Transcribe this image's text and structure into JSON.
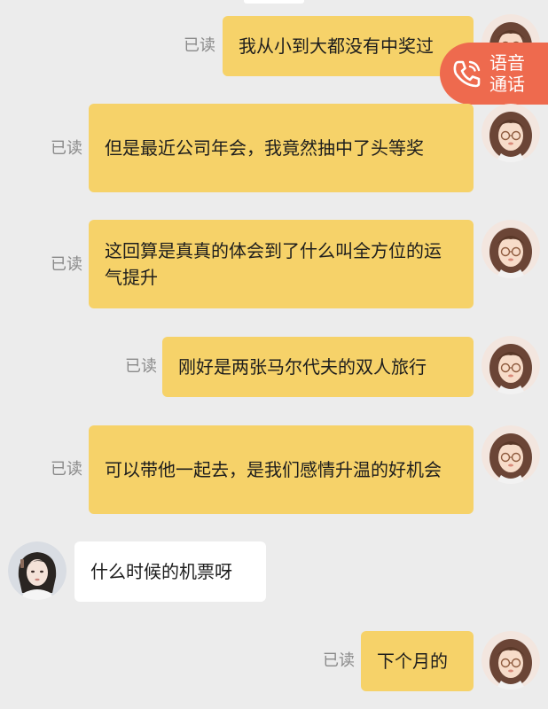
{
  "read_label": "已读",
  "messages": [
    {
      "sender": "me",
      "text": "我从小到大都没有中奖过",
      "read": "已读"
    },
    {
      "sender": "me",
      "text": "但是最近公司年会，我竟然抽中了头等奖",
      "read": "已读"
    },
    {
      "sender": "me",
      "text": "这回算是真真的体会到了什么叫全方位的运气提升",
      "read": "已读"
    },
    {
      "sender": "me",
      "text": "刚好是两张马尔代夫的双人旅行",
      "read": "已读"
    },
    {
      "sender": "me",
      "text": "可以带他一起去，是我们感情升温的好机会",
      "read": "已读"
    },
    {
      "sender": "other",
      "text": "什么时候的机票呀"
    },
    {
      "sender": "me",
      "text": "下个月的",
      "read": "已读"
    }
  ],
  "voice_call": {
    "label": "语音通话",
    "icon": "phone-icon"
  },
  "colors": {
    "my_bubble": "#f6d269",
    "their_bubble": "#ffffff",
    "call_button": "#ee6a4e",
    "background": "#ececec"
  }
}
